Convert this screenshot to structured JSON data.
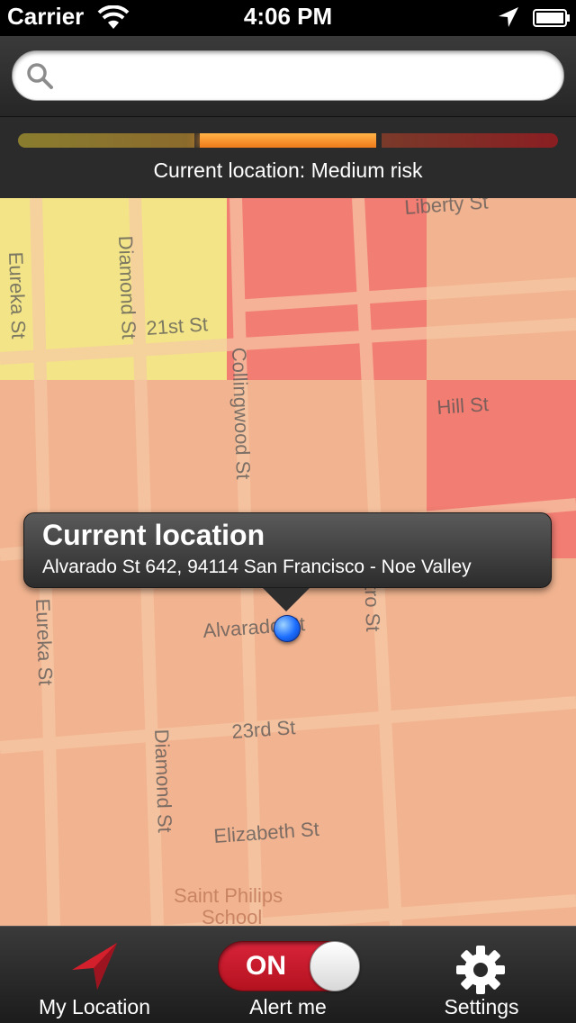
{
  "status_bar": {
    "carrier": "Carrier",
    "time": "4:06 PM",
    "icons": [
      "wifi-icon",
      "location-services-icon",
      "battery-icon"
    ]
  },
  "search": {
    "placeholder": "",
    "value": "",
    "icon": "search-icon"
  },
  "risk": {
    "levels": [
      "low",
      "medium",
      "high"
    ],
    "active_level": "medium",
    "text": "Current location: Medium risk",
    "colors": {
      "low": "#8a7d2e",
      "medium": "#f07a1a",
      "high": "#8a1e22"
    }
  },
  "map": {
    "zone_colors": {
      "low": "#f2e487",
      "medium": "#f2b490",
      "high": "#f27d72"
    },
    "street_labels": [
      "Liberty St",
      "Eureka St",
      "Diamond St",
      "21st St",
      "Collingwood St",
      "Hill St",
      "Castro St",
      "Alvarado St",
      "Eureka St",
      "Diamond St",
      "23rd St",
      "Elizabeth St",
      "Saint Philips",
      "School"
    ],
    "callout": {
      "title": "Current location",
      "address": "Alvarado St 642, 94114 San Francisco - Noe Valley"
    }
  },
  "tabbar": {
    "my_location": {
      "label": "My Location",
      "icon": "navigation-arrow-icon"
    },
    "alert": {
      "label": "Alert me",
      "toggle_text": "ON",
      "toggle_on": true
    },
    "settings": {
      "label": "Settings",
      "icon": "gear-icon"
    }
  }
}
